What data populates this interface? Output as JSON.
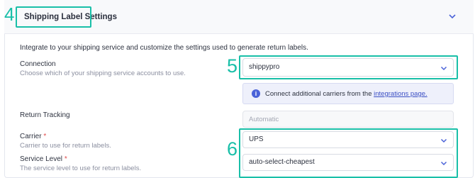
{
  "section": {
    "title": "Shipping Label Settings",
    "intro": "Integrate to your shipping service and customize the settings used to generate return labels."
  },
  "connection": {
    "label": "Connection",
    "help": "Choose which of your shipping service accounts to use.",
    "value": "shippypro"
  },
  "info_banner": {
    "text": "Connect additional carriers from the",
    "link_text": "integrations page."
  },
  "return_tracking": {
    "label": "Return Tracking",
    "value": "Automatic"
  },
  "carrier": {
    "label": "Carrier",
    "required_mark": "*",
    "help": "Carrier to use for return labels.",
    "value": "UPS"
  },
  "service_level": {
    "label": "Service Level",
    "required_mark": "*",
    "help": "The service level to use for return labels.",
    "value": "auto-select-cheapest"
  },
  "callouts": {
    "four": "4",
    "five": "5",
    "six": "6"
  },
  "colors": {
    "annotation": "#19bfa8",
    "link": "#3b4fc4",
    "info_icon": "#4a62d8"
  }
}
